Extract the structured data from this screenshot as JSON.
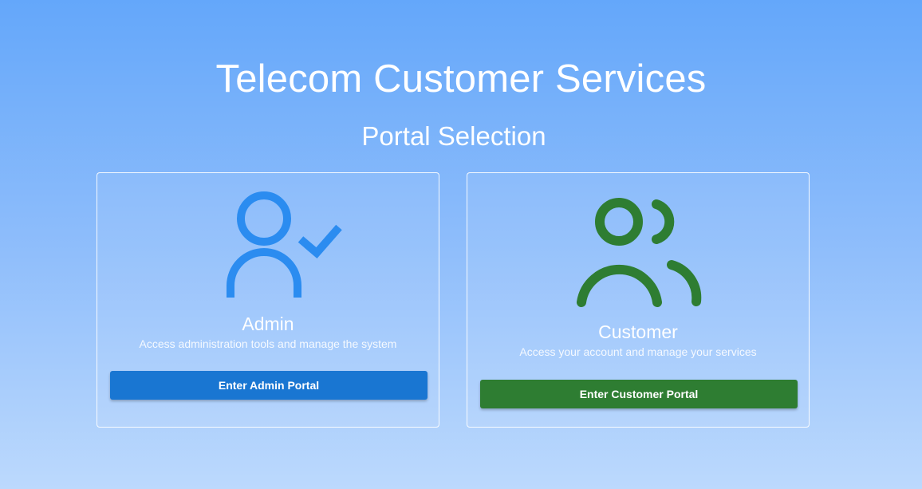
{
  "header": {
    "title": "Telecom Customer Services",
    "subtitle": "Portal Selection"
  },
  "cards": [
    {
      "id": "admin",
      "icon": "admin-user-check-icon",
      "icon_color": "#2b8cf0",
      "title": "Admin",
      "description": "Access administration tools and manage the system",
      "button_label": "Enter Admin Portal",
      "button_color": "#1976d2"
    },
    {
      "id": "customer",
      "icon": "customers-group-icon",
      "icon_color": "#2e7d32",
      "title": "Customer",
      "description": "Access your account and manage your services",
      "button_label": "Enter Customer Portal",
      "button_color": "#2e7d32"
    }
  ]
}
